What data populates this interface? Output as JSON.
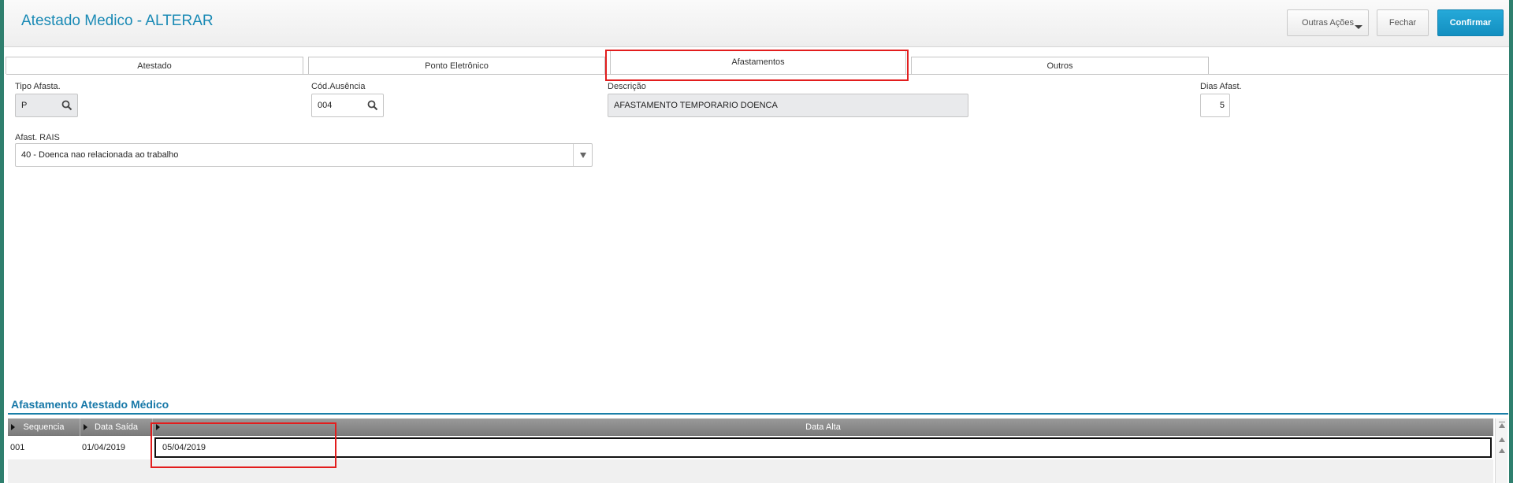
{
  "header": {
    "title": "Atestado Medico - ALTERAR",
    "more_actions_label": "Outras Ações",
    "close_label": "Fechar",
    "confirm_label": "Confirmar"
  },
  "tabs": [
    {
      "label": "Atestado",
      "active": false
    },
    {
      "label": "Ponto Eletrônico",
      "active": false
    },
    {
      "label": "Afastamentos",
      "active": true
    },
    {
      "label": "Outros",
      "active": false
    }
  ],
  "form": {
    "tipo_afasta": {
      "label": "Tipo Afasta.",
      "value": "P",
      "icon": "search-icon"
    },
    "cod_ausencia": {
      "label": "Cód.Ausência",
      "value": "004",
      "icon": "search-icon"
    },
    "descricao": {
      "label": "Descrição",
      "value": "AFASTAMENTO TEMPORARIO DOENCA"
    },
    "dias_afast": {
      "label": "Dias Afast.",
      "value": "5"
    },
    "afast_rais": {
      "label": "Afast. RAIS",
      "value": "40 - Doenca nao relacionada ao trabalho"
    }
  },
  "section": {
    "title": "Afastamento Atestado Médico"
  },
  "grid": {
    "columns": [
      "Sequencia",
      "Data Saída",
      "Data Alta"
    ],
    "rows": [
      {
        "sequencia": "001",
        "data_saida": "01/04/2019",
        "data_alta": "05/04/2019"
      }
    ]
  },
  "colors": {
    "accent": "#1a8ab5",
    "confirm": "#1e9fd0",
    "highlight": "#e21d1d",
    "frame": "#2f7f6e"
  }
}
